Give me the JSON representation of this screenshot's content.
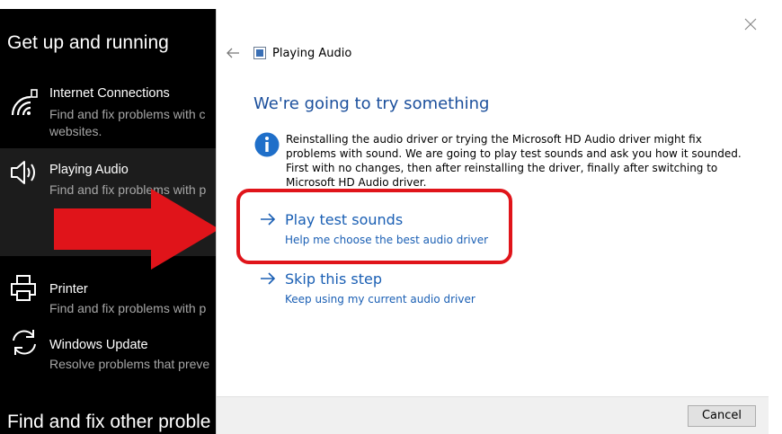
{
  "settings": {
    "heading": "Get up and running",
    "footer_heading": "Find and fix other proble",
    "items": [
      {
        "title": "Internet Connections",
        "sub_line1": "Find and fix problems with c",
        "sub_line2": "websites.",
        "icon": "wifi-icon"
      },
      {
        "title": "Playing Audio",
        "sub_line1": "Find and fix problems with p",
        "icon": "speaker-icon"
      },
      {
        "title": "Printer",
        "sub_line1": "Find and fix problems with p",
        "icon": "printer-icon"
      },
      {
        "title": "Windows Update",
        "sub_line1": "Resolve problems that preve",
        "icon": "refresh-icon"
      }
    ]
  },
  "annotation": {
    "arrow_color": "#e0141a",
    "box_color": "#e0141a"
  },
  "dialog": {
    "title": "Playing Audio",
    "heading": "We're going to try something",
    "info": "Reinstalling the audio driver or trying the Microsoft HD Audio driver might fix problems with sound. We are going to play test sounds and ask you how it sounded. First with no changes, then after reinstalling the driver, finally after switching to Microsoft HD Audio driver.",
    "options": [
      {
        "title": "Play test sounds",
        "sub": "Help me choose the best audio driver"
      },
      {
        "title": "Skip this step",
        "sub": "Keep using my current audio driver"
      }
    ],
    "cancel_label": "Cancel"
  }
}
